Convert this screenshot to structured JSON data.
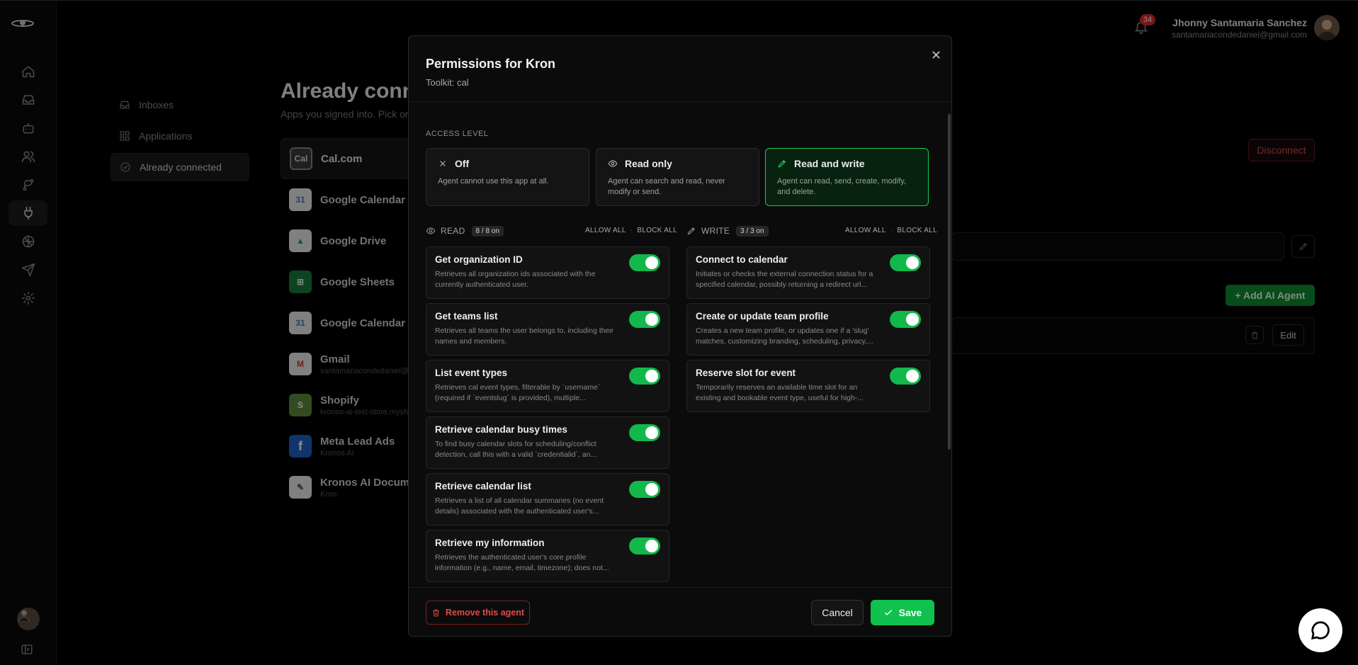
{
  "header": {
    "notifications_count": "34",
    "user_name": "Jhonny Santamaria Sanchez",
    "user_email": "santamariacondedaniel@gmail.com"
  },
  "subnav": {
    "items": [
      {
        "label": "Inboxes",
        "icon": "inbox-icon"
      },
      {
        "label": "Applications",
        "icon": "apps-icon"
      },
      {
        "label": "Already connected",
        "icon": "check-circle-icon"
      }
    ]
  },
  "page": {
    "title": "Already conn",
    "subtitle": "Apps you signed into. Pick or"
  },
  "apps": [
    {
      "name": "Cal.com",
      "sub": "",
      "icon_text": "Cal"
    },
    {
      "name": "Google Calendar",
      "sub": "",
      "icon_text": "31"
    },
    {
      "name": "Google Drive",
      "sub": "",
      "icon_text": "▲"
    },
    {
      "name": "Google Sheets",
      "sub": "",
      "icon_text": "⊞"
    },
    {
      "name": "Google Calendar",
      "sub": "",
      "icon_text": "31"
    },
    {
      "name": "Gmail",
      "sub": "santamariacondedaniel@",
      "icon_text": "M"
    },
    {
      "name": "Shopify",
      "sub": "kronos-ai-test-store.mysh",
      "icon_text": "S"
    },
    {
      "name": "Meta Lead Ads",
      "sub": "Kronos AI",
      "icon_text": "f"
    },
    {
      "name": "Kronos AI Documer",
      "sub": "Kron",
      "icon_text": "✎"
    }
  ],
  "background": {
    "disconnect_label": "Disconnect",
    "add_agent_label": "+ Add AI Agent",
    "edit_label": "Edit"
  },
  "modal": {
    "title": "Permissions for Kron",
    "subtitle": "Toolkit: cal",
    "access_level_label": "ACCESS LEVEL",
    "access_levels": [
      {
        "label": "Off",
        "desc": "Agent cannot use this app at all.",
        "icon": "x-icon"
      },
      {
        "label": "Read only",
        "desc": "Agent can search and read, never modify or send.",
        "icon": "eye-icon"
      },
      {
        "label": "Read and write",
        "desc": "Agent can read, send, create, modify, and delete.",
        "icon": "pencil-icon",
        "selected": true
      }
    ],
    "read": {
      "label": "READ",
      "count": "8 / 8 on",
      "allow_all": "ALLOW ALL",
      "block_all": "BLOCK ALL",
      "items": [
        {
          "title": "Get organization ID",
          "desc": "Retrieves all organization ids associated with the currently authenticated user.",
          "enabled": true
        },
        {
          "title": "Get teams list",
          "desc": "Retrieves all teams the user belongs to, including their names and members.",
          "enabled": true
        },
        {
          "title": "List event types",
          "desc": "Retrieves cal event types, filterable by `username` (required if `eventslug` is provided), multiple...",
          "enabled": true
        },
        {
          "title": "Retrieve calendar busy times",
          "desc": "To find busy calendar slots for scheduling/conflict detection, call this with a valid `credentialid`, an...",
          "enabled": true
        },
        {
          "title": "Retrieve calendar list",
          "desc": "Retrieves a list of all calendar summaries (no event details) associated with the authenticated user's...",
          "enabled": true
        },
        {
          "title": "Retrieve my information",
          "desc": "Retrieves the authenticated user's core profile information (e.g., name, email, timezone); does not...",
          "enabled": true
        }
      ]
    },
    "write": {
      "label": "WRITE",
      "count": "3 / 3 on",
      "allow_all": "ALLOW ALL",
      "block_all": "BLOCK ALL",
      "items": [
        {
          "title": "Connect to calendar",
          "desc": "Initiates or checks the external connection status for a specified calendar, possibly returning a redirect url...",
          "enabled": true
        },
        {
          "title": "Create or update team profile",
          "desc": "Creates a new team profile, or updates one if a 'slug' matches, customizing branding, scheduling, privacy,...",
          "enabled": true
        },
        {
          "title": "Reserve slot for event",
          "desc": "Temporarily reserves an available time slot for an existing and bookable event type, useful for high-...",
          "enabled": true
        }
      ]
    },
    "remove_label": "Remove this agent",
    "cancel_label": "Cancel",
    "save_label": "Save"
  },
  "colors": {
    "accent": "#10c14d",
    "danger": "#e04a4a",
    "badge": "#d92a2a"
  }
}
